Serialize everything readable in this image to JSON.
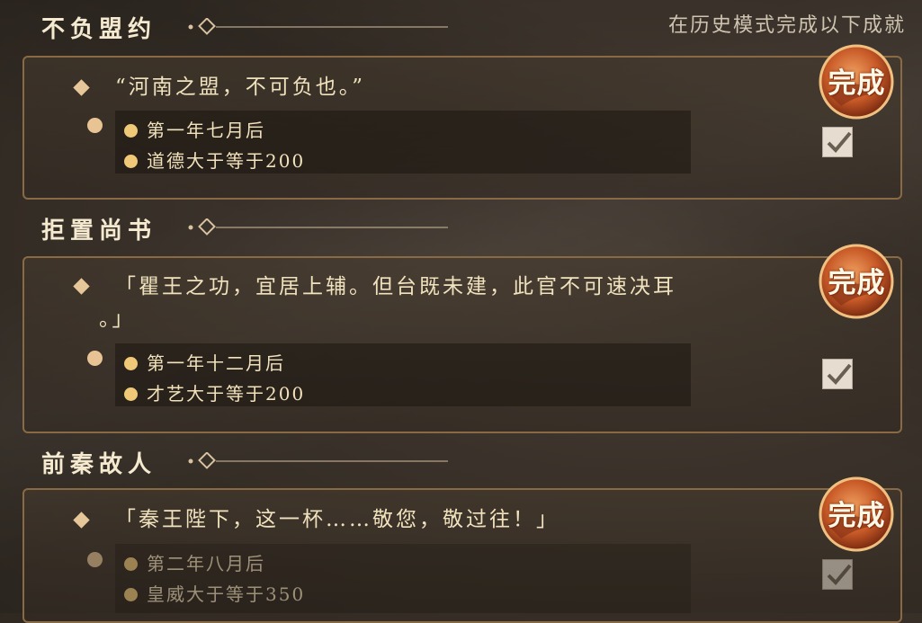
{
  "header": {
    "subtitle": "在历史模式完成以下成就"
  },
  "achievements": [
    {
      "title": "不负盟约",
      "quote": "“河南之盟，不可负也。”",
      "conditions": [
        "第一年七月后",
        "道德大于等于200"
      ],
      "badge": "完成",
      "checked": true
    },
    {
      "title": "拒置尚书",
      "quote_line1": "「瞿王之功，宜居上辅。但台既未建，此官不可速决耳",
      "quote_line2": "。」",
      "conditions": [
        "第一年十二月后",
        "才艺大于等于200"
      ],
      "badge": "完成",
      "checked": true
    },
    {
      "title": "前秦故人",
      "quote": "「秦王陛下，这一杯……敬您，敬过往！」",
      "conditions": [
        "第二年八月后",
        "皇威大于等于350"
      ],
      "badge": "完成",
      "checked": true
    }
  ],
  "colors": {
    "accent": "#e8c494",
    "border": "#8a6a44",
    "badge": "#c85a28"
  }
}
